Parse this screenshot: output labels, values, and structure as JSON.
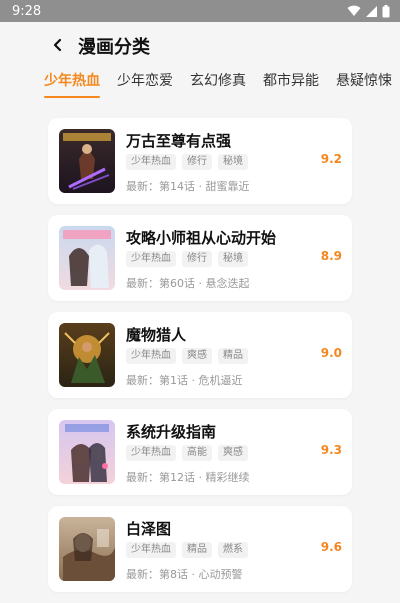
{
  "status_bar": {
    "time": "9:28",
    "wifi_icon": "wifi-icon",
    "signal_icon": "signal-icon",
    "battery_icon": "battery-icon"
  },
  "header": {
    "title": "漫画分类",
    "back_icon": "chevron-left-icon"
  },
  "tabs": [
    {
      "label": "少年热血",
      "active": true
    },
    {
      "label": "少年恋爱",
      "active": false
    },
    {
      "label": "玄幻修真",
      "active": false
    },
    {
      "label": "都市异能",
      "active": false
    },
    {
      "label": "悬疑惊悚",
      "active": false
    }
  ],
  "colors": {
    "accent": "#f5871f",
    "status_bar": "#8f8f8f",
    "background": "#f5f5f5"
  },
  "comics": [
    {
      "title": "万古至尊有点强",
      "tags": [
        "少年热血",
        "修行",
        "秘境"
      ],
      "latest": "最新：第14话 · 甜蜜靠近",
      "score": "9.2"
    },
    {
      "title": "攻略小师祖从心动开始",
      "tags": [
        "少年热血",
        "修行",
        "秘境"
      ],
      "latest": "最新：第60话 · 悬念迭起",
      "score": "8.9"
    },
    {
      "title": "魔物猎人",
      "tags": [
        "少年热血",
        "爽感",
        "精品"
      ],
      "latest": "最新：第1话 · 危机逼近",
      "score": "9.0"
    },
    {
      "title": "系统升级指南",
      "tags": [
        "少年热血",
        "高能",
        "爽感"
      ],
      "latest": "最新：第12话 · 精彩继续",
      "score": "9.3"
    },
    {
      "title": "白泽图",
      "tags": [
        "少年热血",
        "精品",
        "燃系"
      ],
      "latest": "最新：第8话 · 心动预警",
      "score": "9.6"
    }
  ]
}
